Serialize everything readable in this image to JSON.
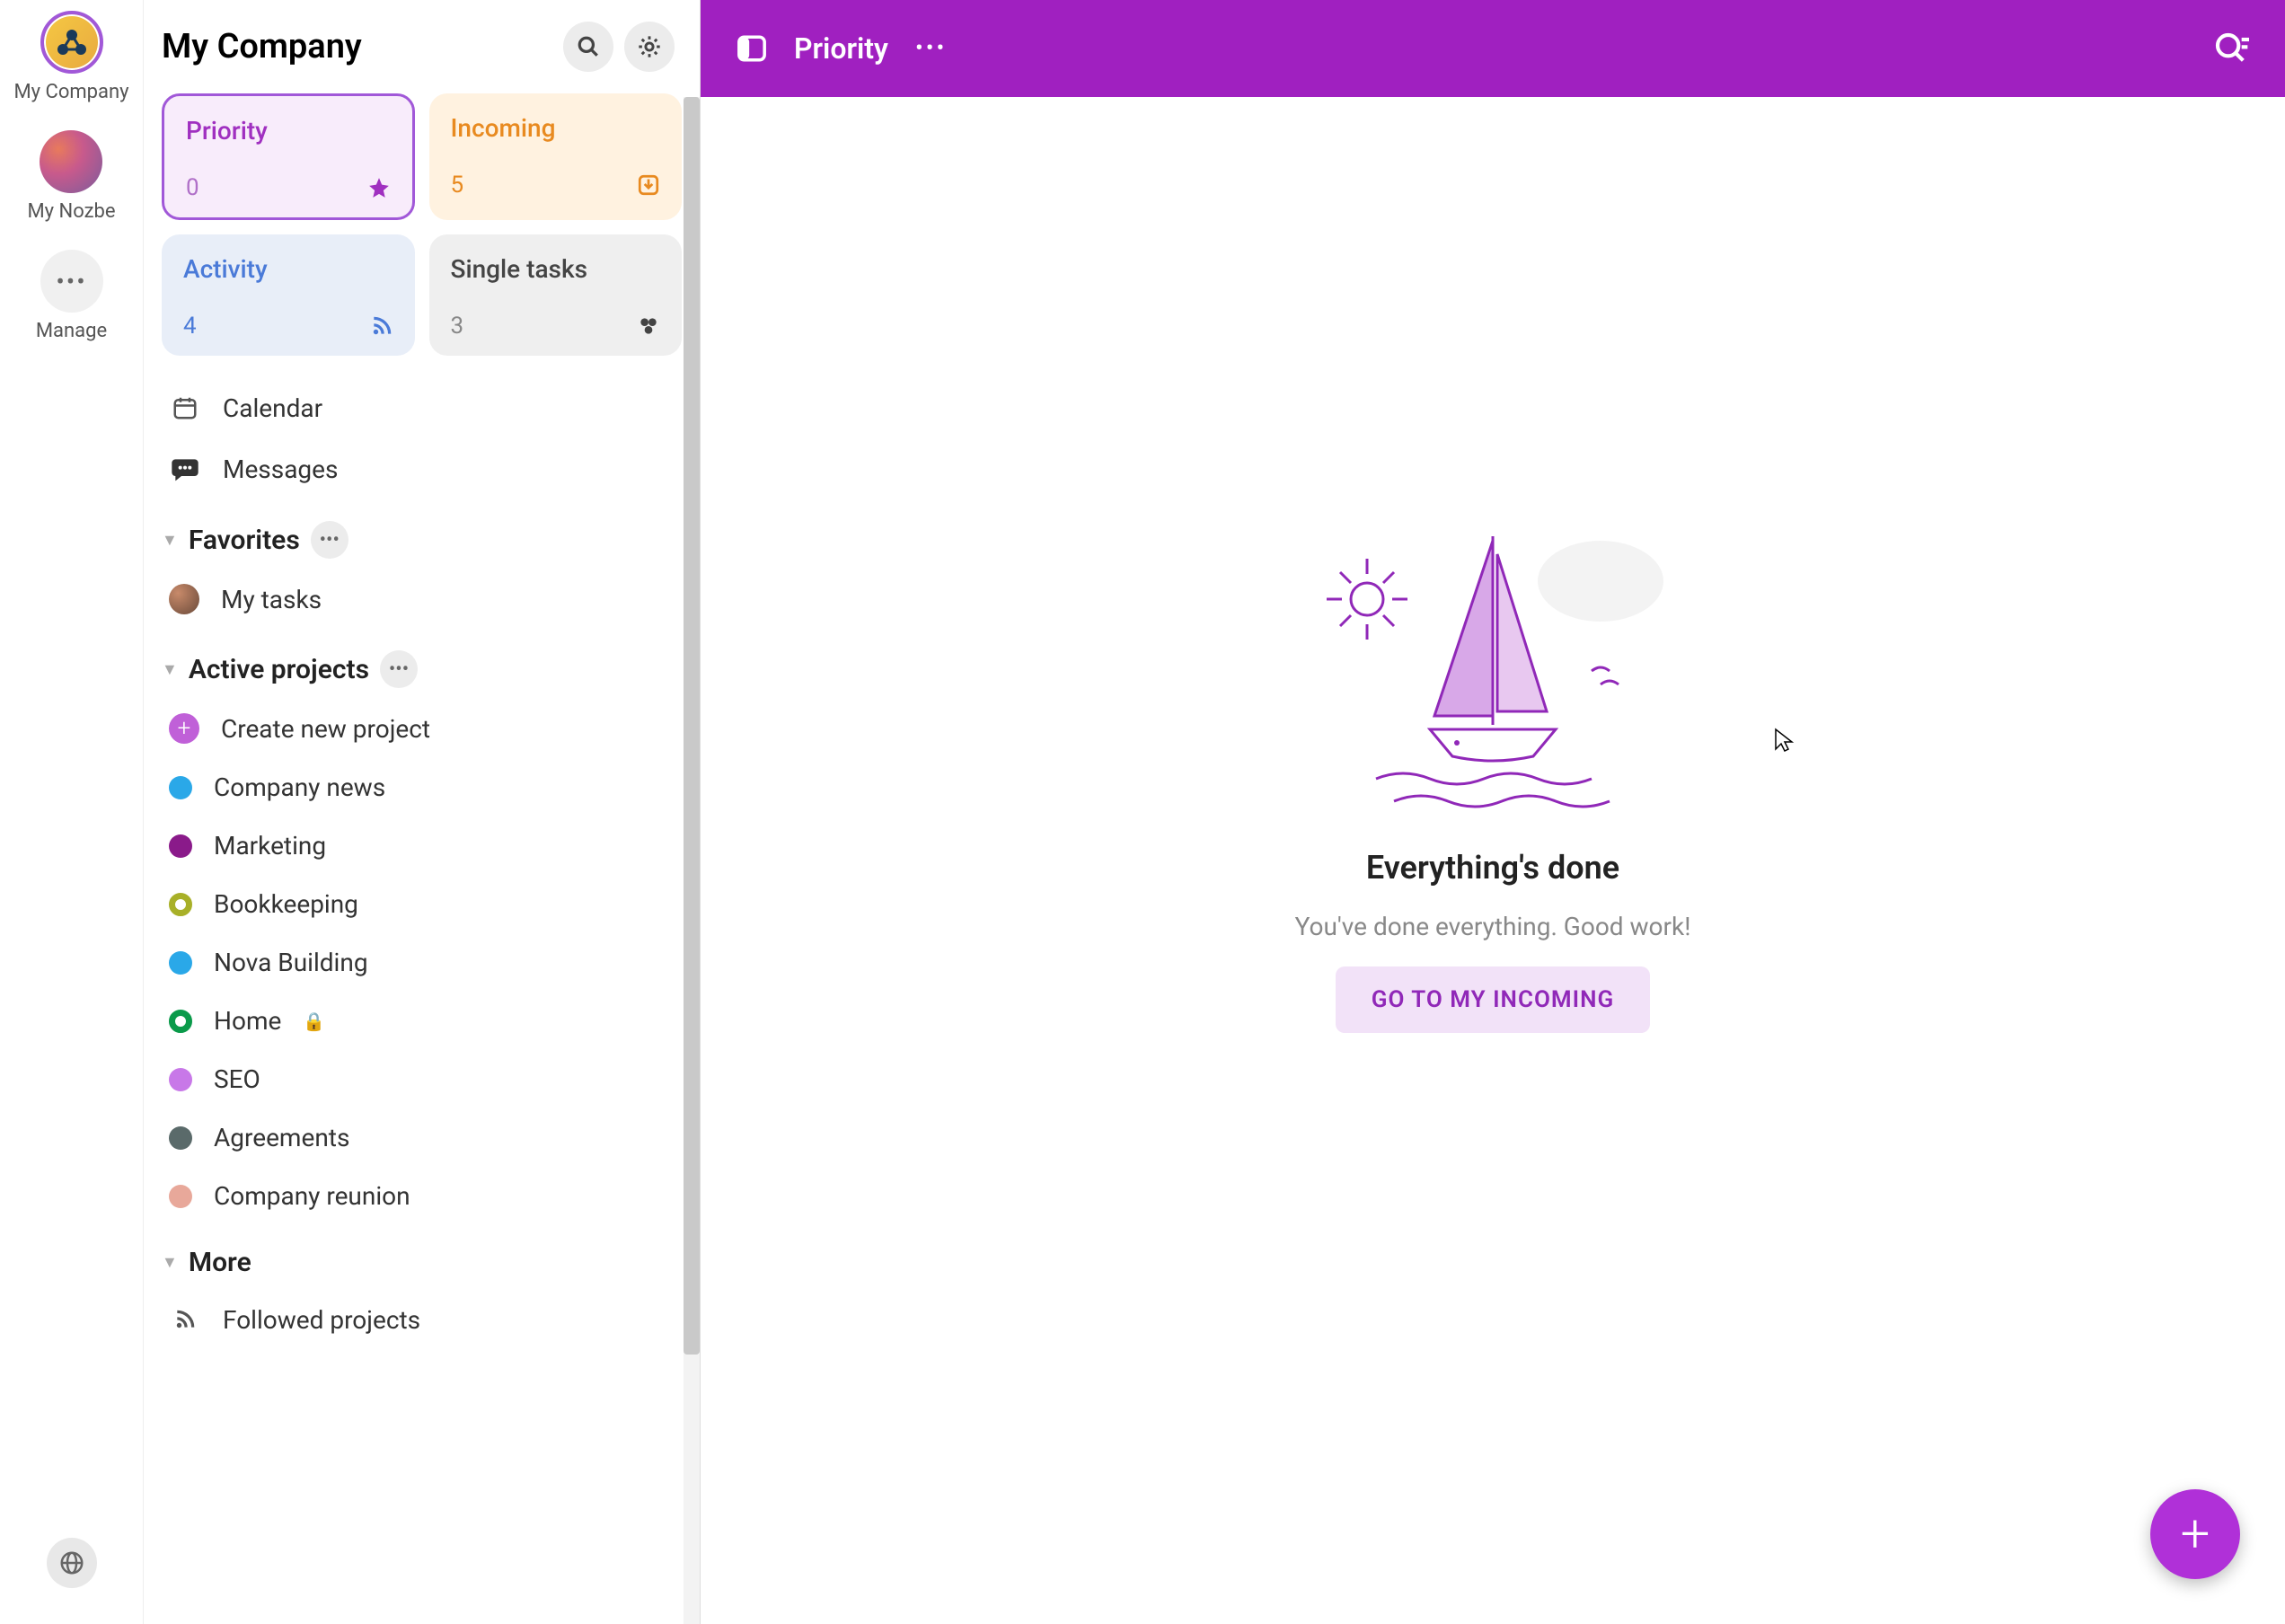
{
  "rail": {
    "company": "My Company",
    "nozbe": "My Nozbe",
    "manage": "Manage",
    "manage_dots": "•••"
  },
  "sidebar": {
    "title": "My Company",
    "cards": {
      "priority": {
        "label": "Priority",
        "count": "0"
      },
      "incoming": {
        "label": "Incoming",
        "count": "5"
      },
      "activity": {
        "label": "Activity",
        "count": "4"
      },
      "single": {
        "label": "Single tasks",
        "count": "3"
      }
    },
    "calendar": "Calendar",
    "messages": "Messages",
    "favorites": {
      "title": "Favorites",
      "items": [
        "My tasks"
      ]
    },
    "active_projects": {
      "title": "Active projects",
      "create": "Create new project",
      "items": [
        {
          "label": "Company news",
          "color": "#2aa8e8"
        },
        {
          "label": "Marketing",
          "color": "#8a1a8a"
        },
        {
          "label": "Bookkeeping",
          "color": "#a8b028",
          "ring": true
        },
        {
          "label": "Nova Building",
          "color": "#2aa8e8"
        },
        {
          "label": "Home",
          "color": "#0a9a4a",
          "ring": true,
          "lock": true
        },
        {
          "label": "SEO",
          "color": "#c878e8"
        },
        {
          "label": "Agreements",
          "color": "#5a6a6a"
        },
        {
          "label": "Company reunion",
          "color": "#e8a89a"
        }
      ]
    },
    "more": {
      "title": "More",
      "followed": "Followed projects"
    }
  },
  "main": {
    "title": "Priority",
    "empty_title": "Everything's done",
    "empty_sub": "You've done everything. Good work!",
    "cta": "GO TO MY INCOMING"
  },
  "colors": {
    "brand": "#a020c0",
    "brand_light": "#c060d8"
  }
}
